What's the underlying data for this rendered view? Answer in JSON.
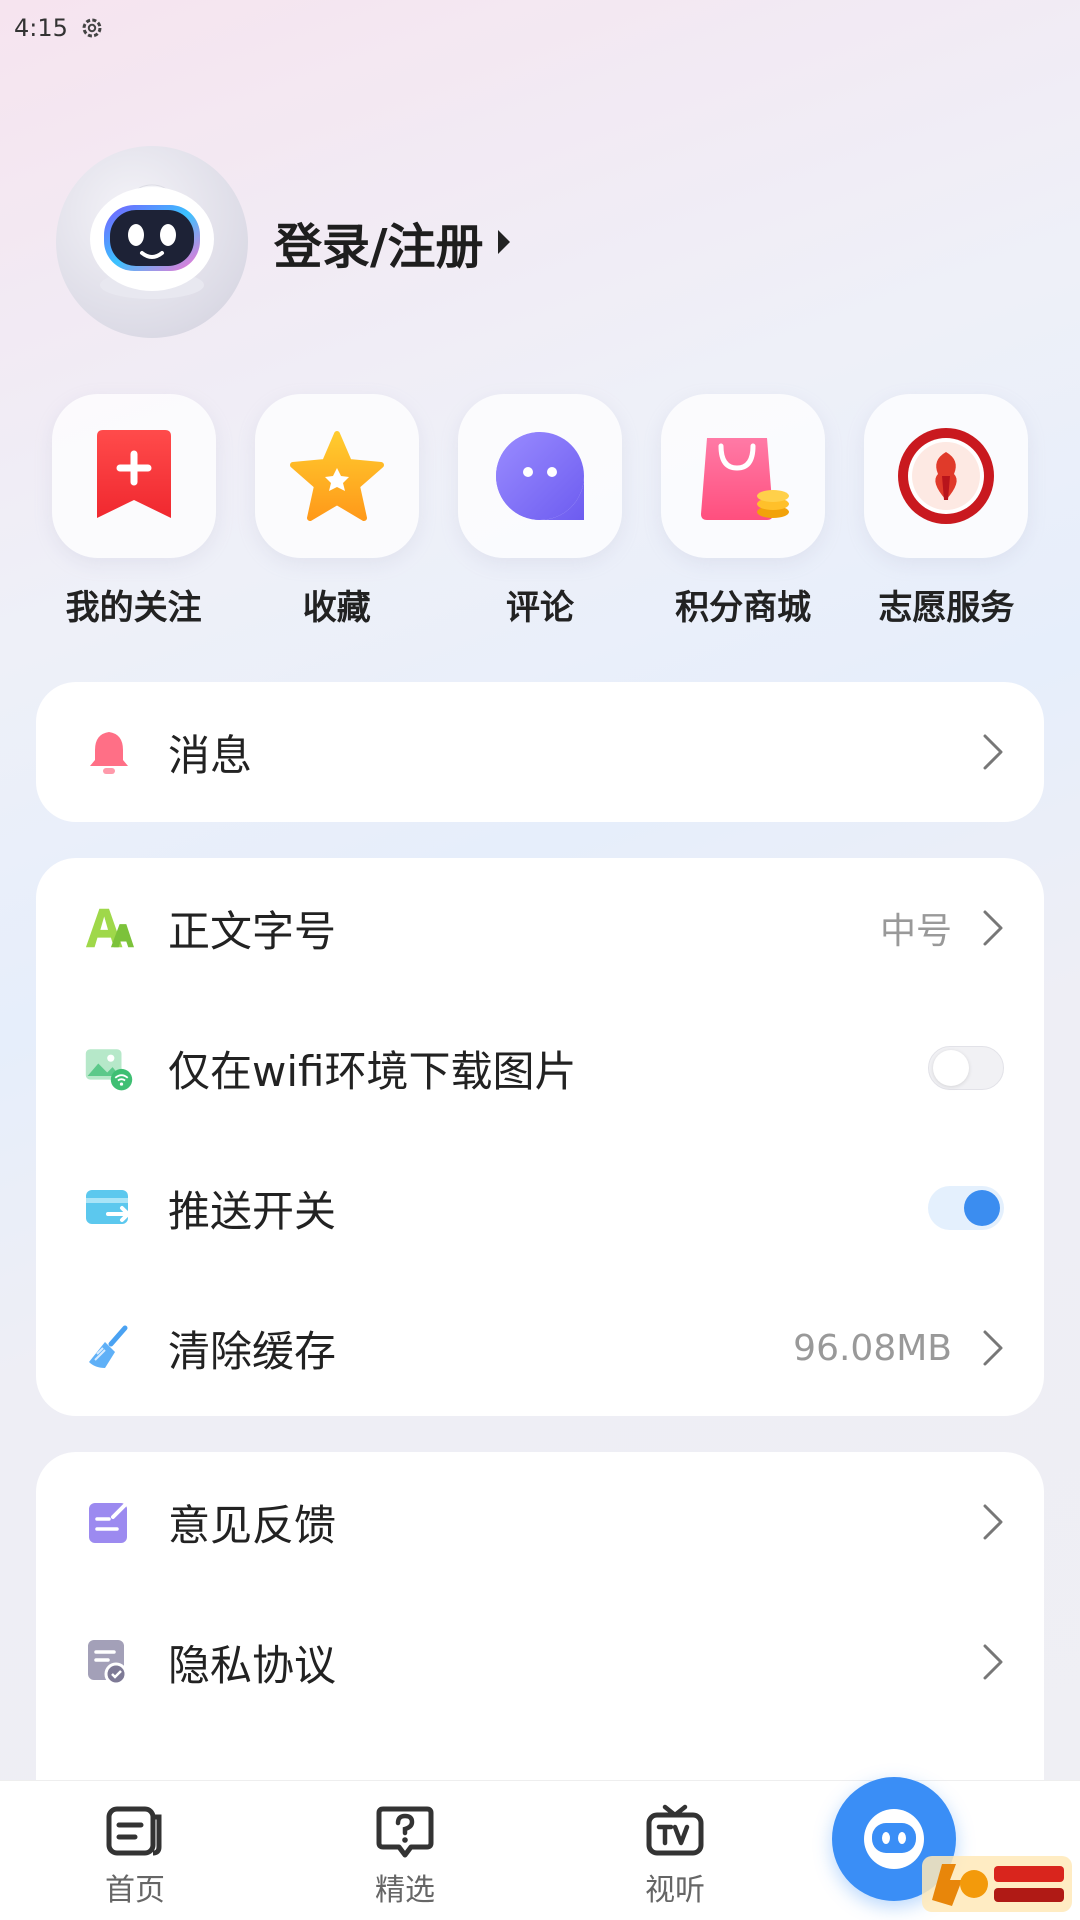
{
  "status_bar": {
    "time": "4:15"
  },
  "profile": {
    "login_label": "登录/注册"
  },
  "shortcuts": [
    {
      "label": "我的关注",
      "icon": "bookmark-plus-icon"
    },
    {
      "label": "收藏",
      "icon": "star-icon"
    },
    {
      "label": "评论",
      "icon": "chat-bubble-icon"
    },
    {
      "label": "积分商城",
      "icon": "shopping-bag-coins-icon"
    },
    {
      "label": "志愿服务",
      "icon": "volunteer-emblem-icon"
    }
  ],
  "messages": {
    "label": "消息",
    "icon": "bell-icon"
  },
  "settings": {
    "font_size": {
      "label": "正文字号",
      "value": "中号",
      "icon": "font-size-icon"
    },
    "wifi_images": {
      "label": "仅在wifi环境下载图片",
      "enabled": false,
      "icon": "image-wifi-icon"
    },
    "push": {
      "label": "推送开关",
      "enabled": true,
      "icon": "push-icon"
    },
    "cache": {
      "label": "清除缓存",
      "value": "96.08MB",
      "icon": "broom-icon"
    }
  },
  "misc": {
    "feedback": {
      "label": "意见反馈",
      "icon": "feedback-icon"
    },
    "privacy": {
      "label": "隐私协议",
      "icon": "privacy-icon"
    }
  },
  "tabbar": {
    "home": "首页",
    "featured": "精选",
    "video": "视听"
  },
  "colors": {
    "accent": "#3a8ef6",
    "toggle_on": "#3b8df0"
  }
}
